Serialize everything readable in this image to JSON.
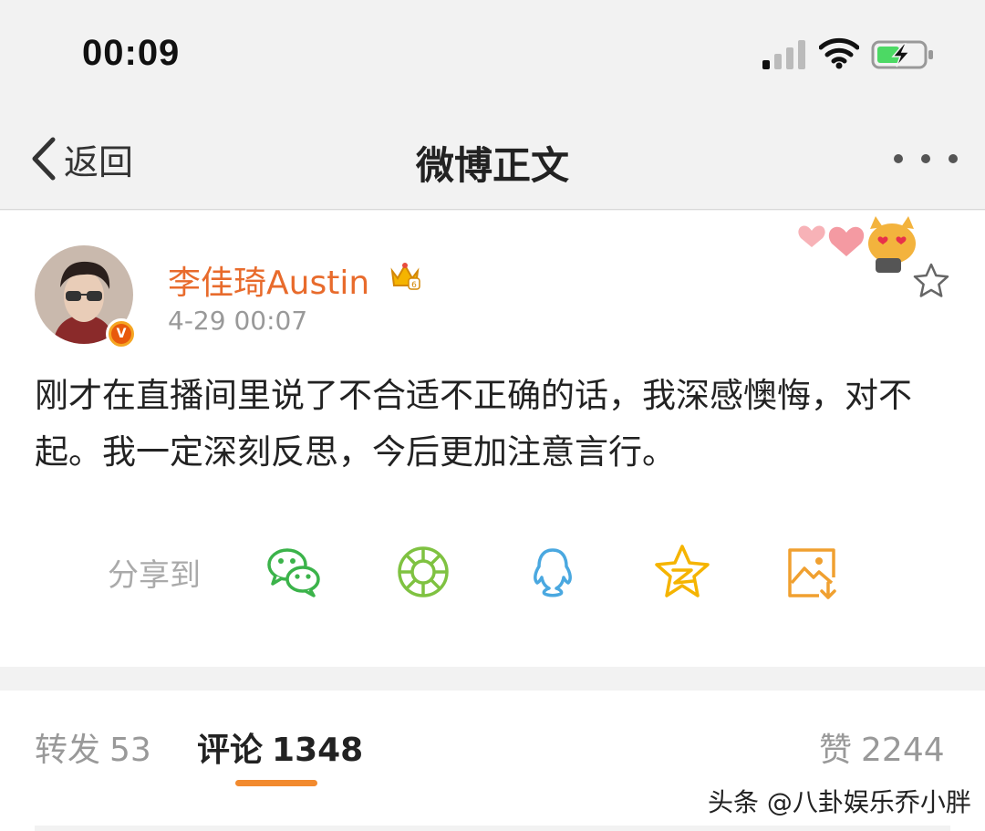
{
  "status_bar": {
    "time": "00:09"
  },
  "nav": {
    "back_label": "返回",
    "title": "微博正文"
  },
  "post": {
    "author": "李佳琦Austin",
    "timestamp": "4-29 00:07",
    "text": "刚才在直播间里说了不合适不正确的话，我深感懊悔，对不起。我一定深刻反思，今后更加注意言行。",
    "share_label": "分享到",
    "share_targets": [
      "wechat-icon",
      "moments-icon",
      "qq-icon",
      "qzone-icon",
      "save-image-icon"
    ]
  },
  "tabs": {
    "repost": {
      "label": "转发",
      "count": "53"
    },
    "comment": {
      "label": "评论",
      "count": "1348"
    },
    "like": {
      "label": "赞",
      "count": "2244"
    }
  },
  "watermark": "头条 @八卦娱乐乔小胖",
  "colors": {
    "accent": "#f28a2e",
    "username": "#e86b2c",
    "wechat": "#3bb34a",
    "qq": "#4aa8e0",
    "qzone": "#f5b400"
  }
}
